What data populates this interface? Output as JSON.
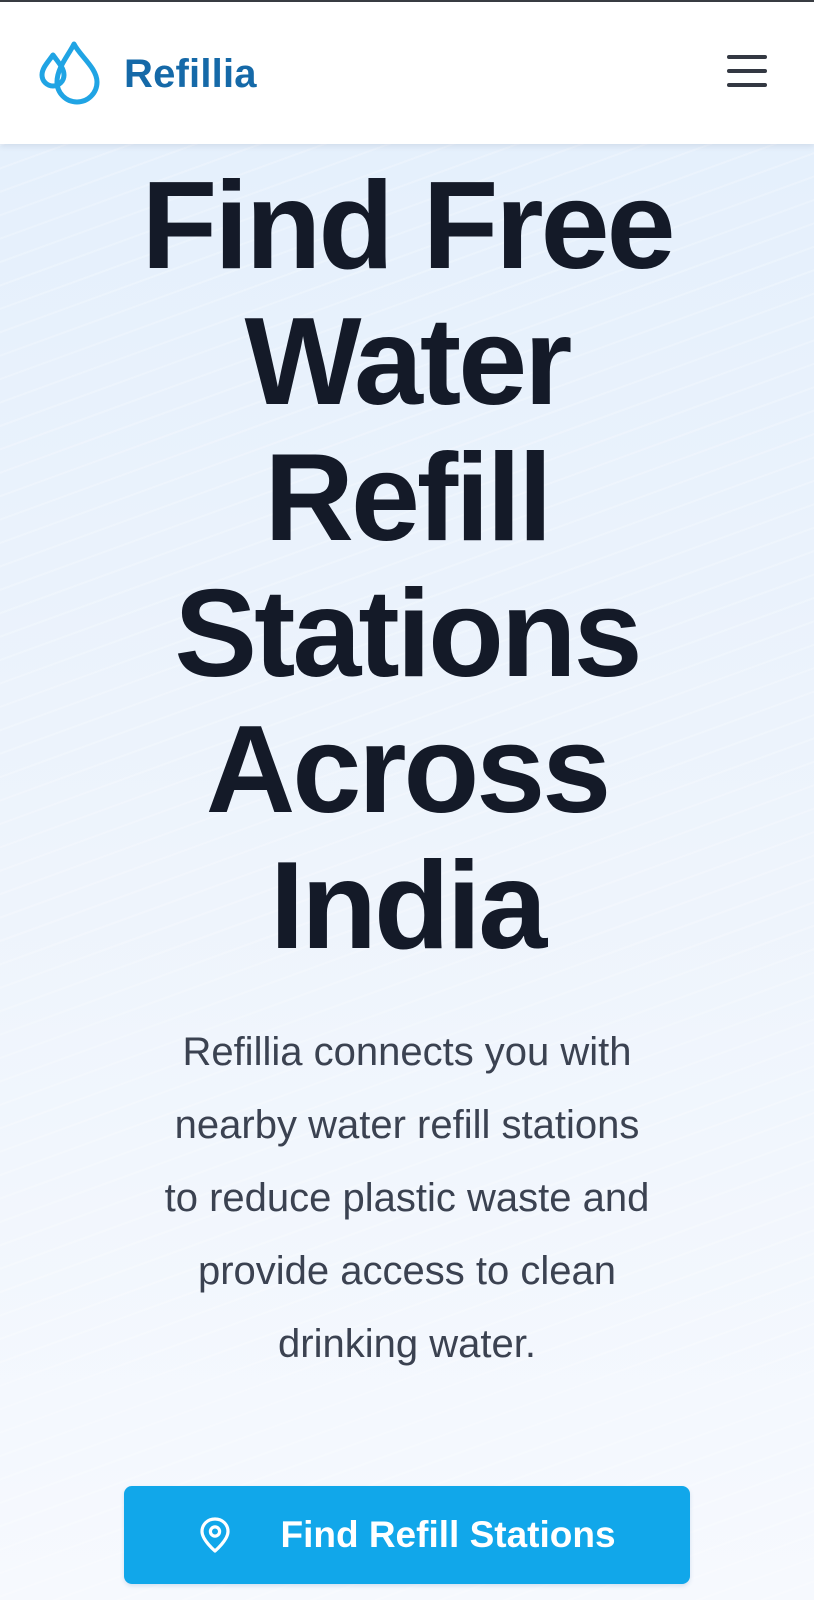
{
  "header": {
    "brand_name": "Refillia",
    "logo_icon": "water-drops-icon",
    "menu_icon": "hamburger-menu-icon",
    "brand_color": "#1569a8",
    "accent_color": "#20a4e4"
  },
  "hero": {
    "headline_lines": [
      "Find Free",
      "Water",
      "Refill",
      "Stations",
      "Across",
      "India"
    ],
    "description_lines": [
      "Refillia connects you with",
      "nearby water refill stations",
      "to reduce plastic waste and",
      "provide access to clean",
      "drinking water."
    ],
    "headline_color": "#141a28",
    "description_color": "#3b4251"
  },
  "cta": {
    "label": "Find Refill Stations",
    "icon": "map-pin-icon",
    "color": "#11a7ea"
  }
}
